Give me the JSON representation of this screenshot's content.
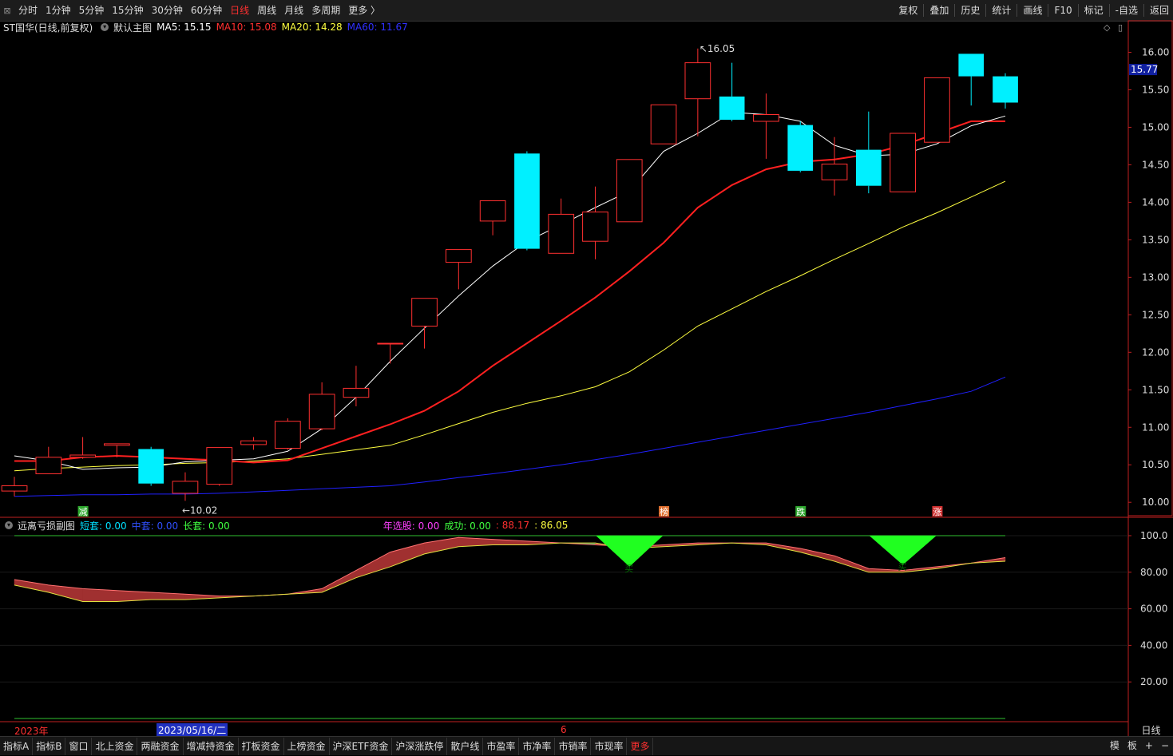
{
  "toolbar": {
    "left": [
      "分时",
      "1分钟",
      "5分钟",
      "15分钟",
      "30分钟",
      "60分钟",
      "日线",
      "周线",
      "月线",
      "多周期",
      "更多 〉"
    ],
    "active": "日线",
    "right": [
      "复权",
      "叠加",
      "历史",
      "统计",
      "画线",
      "F10",
      "标记",
      "-自选",
      "返回"
    ]
  },
  "info": {
    "title": "ST国华(日线,前复权)",
    "main_chart": "默认主图",
    "ma5": "MA5: 15.15",
    "ma10": "MA10: 15.08",
    "ma20": "MA20: 14.28",
    "ma60": "MA60: 11.67"
  },
  "sub_info": {
    "name": "远离亏损副图",
    "short": "短套: 0.00",
    "mid": "中套: 0.00",
    "long": "长套: 0.00",
    "year_pick": "年选股: 0.00",
    "success": "成功: 0.00",
    "v1": ": 88.17",
    "v2": ": 86.05"
  },
  "price_axis": [
    "16.00",
    "15.50",
    "15.00",
    "14.50",
    "14.00",
    "13.50",
    "13.00",
    "12.50",
    "12.00",
    "11.50",
    "11.00",
    "10.50",
    "10.00"
  ],
  "current_price": "15.77",
  "sub_axis": [
    "100.0",
    "80.00",
    "60.00",
    "40.00",
    "20.00"
  ],
  "annotations": {
    "high": "16.05",
    "low": "10.02"
  },
  "signals": [
    {
      "label": "减",
      "x_index": 2,
      "color": "#2ea82e"
    },
    {
      "label": "榜",
      "x_index": 19,
      "color": "#e07030"
    },
    {
      "label": "跌",
      "x_index": 23,
      "color": "#2ea82e"
    },
    {
      "label": "涨",
      "x_index": 27,
      "color": "#d03030"
    }
  ],
  "buy_label": "买",
  "dates": {
    "year": "2023年",
    "selected": "2023/05/16/二",
    "month": "6"
  },
  "period": "日线",
  "bottom_tabs": [
    "指标A",
    "指标B",
    "窗口",
    "北上资金",
    "两融资金",
    "增减持资金",
    "打板资金",
    "上榜资金",
    "沪深ETF资金",
    "沪深涨跌停",
    "散户线",
    "市盈率",
    "市净率",
    "市销率",
    "市现率",
    "更多"
  ],
  "bottom_right": [
    "模",
    "板",
    "+",
    "−"
  ],
  "colors": {
    "up": "#ff3030",
    "down": "#00f0ff",
    "ma5": "#ffffff",
    "ma10": "#ff2020",
    "ma20": "#ffff40",
    "ma60": "#2020ff"
  },
  "chart_data": {
    "type": "candlestick",
    "price_range": [
      9.8,
      16.25
    ],
    "candles": [
      {
        "o": 10.15,
        "c": 10.22,
        "h": 10.34,
        "l": 10.08
      },
      {
        "o": 10.38,
        "c": 10.6,
        "h": 10.74,
        "l": 10.38
      },
      {
        "o": 10.6,
        "c": 10.63,
        "h": 10.87,
        "l": 10.58
      },
      {
        "o": 10.76,
        "c": 10.78,
        "h": 10.78,
        "l": 10.6
      },
      {
        "o": 10.71,
        "c": 10.25,
        "h": 10.74,
        "l": 10.22
      },
      {
        "o": 10.12,
        "c": 10.28,
        "h": 10.4,
        "l": 10.02
      },
      {
        "o": 10.24,
        "c": 10.73,
        "h": 10.73,
        "l": 10.22
      },
      {
        "o": 10.77,
        "c": 10.82,
        "h": 10.87,
        "l": 10.7
      },
      {
        "o": 10.72,
        "c": 11.08,
        "h": 11.12,
        "l": 10.7
      },
      {
        "o": 10.98,
        "c": 11.44,
        "h": 11.6,
        "l": 10.96
      },
      {
        "o": 11.4,
        "c": 11.52,
        "h": 11.82,
        "l": 11.28
      },
      {
        "o": 12.12,
        "c": 12.12,
        "h": 12.12,
        "l": 11.85
      },
      {
        "o": 12.35,
        "c": 12.72,
        "h": 12.72,
        "l": 12.05
      },
      {
        "o": 13.2,
        "c": 13.37,
        "h": 13.37,
        "l": 12.84
      },
      {
        "o": 13.75,
        "c": 14.02,
        "h": 14.02,
        "l": 13.56
      },
      {
        "o": 14.65,
        "c": 13.38,
        "h": 14.68,
        "l": 13.36
      },
      {
        "o": 13.32,
        "c": 13.84,
        "h": 14.05,
        "l": 13.32
      },
      {
        "o": 13.48,
        "c": 13.87,
        "h": 14.21,
        "l": 13.24
      },
      {
        "o": 13.74,
        "c": 14.57,
        "h": 14.57,
        "l": 13.74
      },
      {
        "o": 14.78,
        "c": 15.3,
        "h": 15.3,
        "l": 14.78
      },
      {
        "o": 15.38,
        "c": 15.86,
        "h": 16.05,
        "l": 14.88
      },
      {
        "o": 15.41,
        "c": 15.1,
        "h": 15.86,
        "l": 15.08
      },
      {
        "o": 15.08,
        "c": 15.17,
        "h": 15.45,
        "l": 14.58
      },
      {
        "o": 15.03,
        "c": 14.42,
        "h": 15.08,
        "l": 14.4
      },
      {
        "o": 14.3,
        "c": 14.51,
        "h": 14.87,
        "l": 14.09
      },
      {
        "o": 14.7,
        "c": 14.22,
        "h": 15.21,
        "l": 14.12
      },
      {
        "o": 14.14,
        "c": 14.92,
        "h": 14.92,
        "l": 14.14
      },
      {
        "o": 14.8,
        "c": 15.66,
        "h": 15.66,
        "l": 14.8
      },
      {
        "o": 15.98,
        "c": 15.68,
        "h": 15.98,
        "l": 15.29
      },
      {
        "o": 15.68,
        "c": 15.33,
        "h": 15.72,
        "l": 15.25
      }
    ],
    "ma5": [
      10.62,
      10.55,
      10.44,
      10.46,
      10.47,
      10.54,
      10.56,
      10.58,
      10.68,
      10.98,
      11.4,
      11.88,
      12.32,
      12.75,
      13.15,
      13.48,
      13.7,
      13.93,
      14.15,
      14.68,
      14.92,
      15.2,
      15.17,
      15.08,
      14.76,
      14.62,
      14.64,
      14.78,
      15.02,
      15.15
    ],
    "ma10": [
      10.55,
      10.55,
      10.6,
      10.62,
      10.6,
      10.58,
      10.56,
      10.53,
      10.56,
      10.72,
      10.88,
      11.04,
      11.22,
      11.48,
      11.82,
      12.12,
      12.42,
      12.73,
      13.08,
      13.46,
      13.93,
      14.23,
      14.44,
      14.54,
      14.57,
      14.64,
      14.76,
      14.92,
      15.08,
      15.08
    ],
    "ma20": [
      10.42,
      10.45,
      10.47,
      10.49,
      10.5,
      10.52,
      10.53,
      10.55,
      10.58,
      10.64,
      10.7,
      10.76,
      10.9,
      11.05,
      11.2,
      11.32,
      11.42,
      11.54,
      11.74,
      12.03,
      12.35,
      12.58,
      12.81,
      13.02,
      13.24,
      13.45,
      13.67,
      13.86,
      14.07,
      14.28
    ],
    "ma60": [
      10.08,
      10.09,
      10.1,
      10.1,
      10.11,
      10.11,
      10.12,
      10.14,
      10.16,
      10.18,
      10.2,
      10.22,
      10.27,
      10.33,
      10.38,
      10.44,
      10.5,
      10.57,
      10.64,
      10.72,
      10.8,
      10.88,
      10.96,
      11.04,
      11.12,
      11.2,
      11.29,
      11.38,
      11.48,
      11.67
    ],
    "sub_range": [
      0,
      100
    ],
    "sub_series_a": [
      76,
      73,
      71,
      70,
      69,
      68,
      67,
      67,
      68,
      71,
      81,
      91,
      96,
      99,
      98,
      97,
      96,
      95,
      94,
      95,
      96,
      96,
      96,
      93,
      89,
      82,
      81,
      83,
      85,
      88
    ],
    "sub_series_b": [
      73,
      69,
      64,
      64,
      65,
      65,
      66,
      67,
      68,
      69,
      77,
      83,
      90,
      94,
      95,
      95,
      96,
      96,
      93,
      94,
      95,
      96,
      95,
      91,
      86,
      80,
      80,
      82,
      85,
      86
    ],
    "sub_buy_points": [
      {
        "index": 18,
        "value": 83
      },
      {
        "index": 26,
        "value": 84
      }
    ]
  }
}
